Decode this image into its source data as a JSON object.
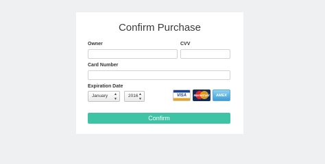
{
  "form": {
    "title": "Confirm Purchase",
    "owner_label": "Owner",
    "owner_value": "",
    "cvv_label": "CVV",
    "cvv_value": "",
    "card_number_label": "Card Number",
    "card_number_value": "",
    "expiration_label": "Expiration Date",
    "month_selected": "January",
    "year_selected": "2016",
    "confirm_label": "Confirm"
  },
  "card_logos": [
    {
      "name": "visa-icon",
      "text": "VISA"
    },
    {
      "name": "mastercard-icon",
      "text": "MasterCard"
    },
    {
      "name": "amex-icon",
      "text": "AMEX"
    }
  ],
  "colors": {
    "accent": "#3ec3a4",
    "background": "#eef0f2",
    "panel": "#ffffff"
  }
}
